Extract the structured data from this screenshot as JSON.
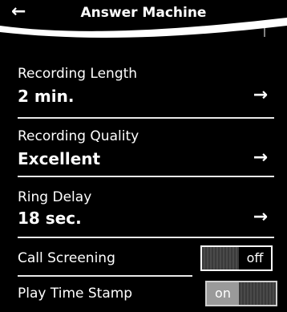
{
  "header": {
    "title": "Answer Machine",
    "back_icon": "back-arrow-icon"
  },
  "settings": [
    {
      "label": "Recording Length",
      "value": "2 min."
    },
    {
      "label": "Recording Quality",
      "value": "Excellent"
    },
    {
      "label": "Ring Delay",
      "value": "18 sec."
    }
  ],
  "toggles": [
    {
      "label": "Call Screening",
      "state": "off"
    },
    {
      "label": "Play Time Stamp",
      "state": "on"
    }
  ],
  "colors": {
    "background": "#000000",
    "text": "#ffffff",
    "toggle_on": "#9a9a9a"
  }
}
